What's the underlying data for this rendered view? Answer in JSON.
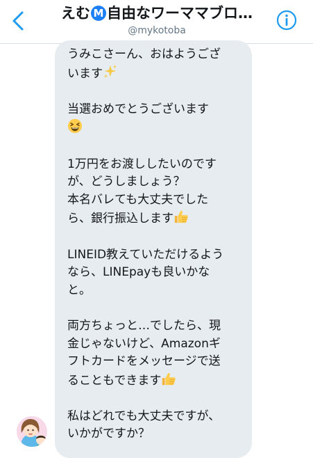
{
  "header": {
    "title_before": "えむ",
    "title_badge": "M",
    "title_after": "自由なワーママブロ…",
    "handle": "@mykotoba"
  },
  "message": {
    "segments": [
      {
        "text": "うみこさーん、おはようござ\nいます"
      },
      {
        "emoji": "sparkles-emoji"
      },
      {
        "text": "\n\n当選おめでとうございます\n"
      },
      {
        "emoji": "grinning-squint-emoji"
      },
      {
        "text": "\n\n1万円をお渡ししたいのです\nが、どうしましょう？\n本名バレても大丈夫でした\nら、銀行振込します"
      },
      {
        "emoji": "thumbs-up-emoji"
      },
      {
        "text": "\n\nLINEID教えていただけるよう\nなら、LINEpayも良いかな\nと。\n\n両方ちょっと…でしたら、現\n金じゃないけど、Amazonギ\nフトカードをメッセージで送\nることもできます"
      },
      {
        "emoji": "thumbs-up-emoji"
      },
      {
        "text": "\n\n私はどれでも大丈夫ですが、\nいかがですか？"
      }
    ]
  },
  "colors": {
    "accent": "#1d9bf0",
    "bubble": "#e6ecf0",
    "text": "#14171a",
    "secondary_text": "#657786"
  },
  "icons": {
    "back": "chevron-left-icon",
    "info": "info-icon",
    "avatar": "avatar"
  }
}
